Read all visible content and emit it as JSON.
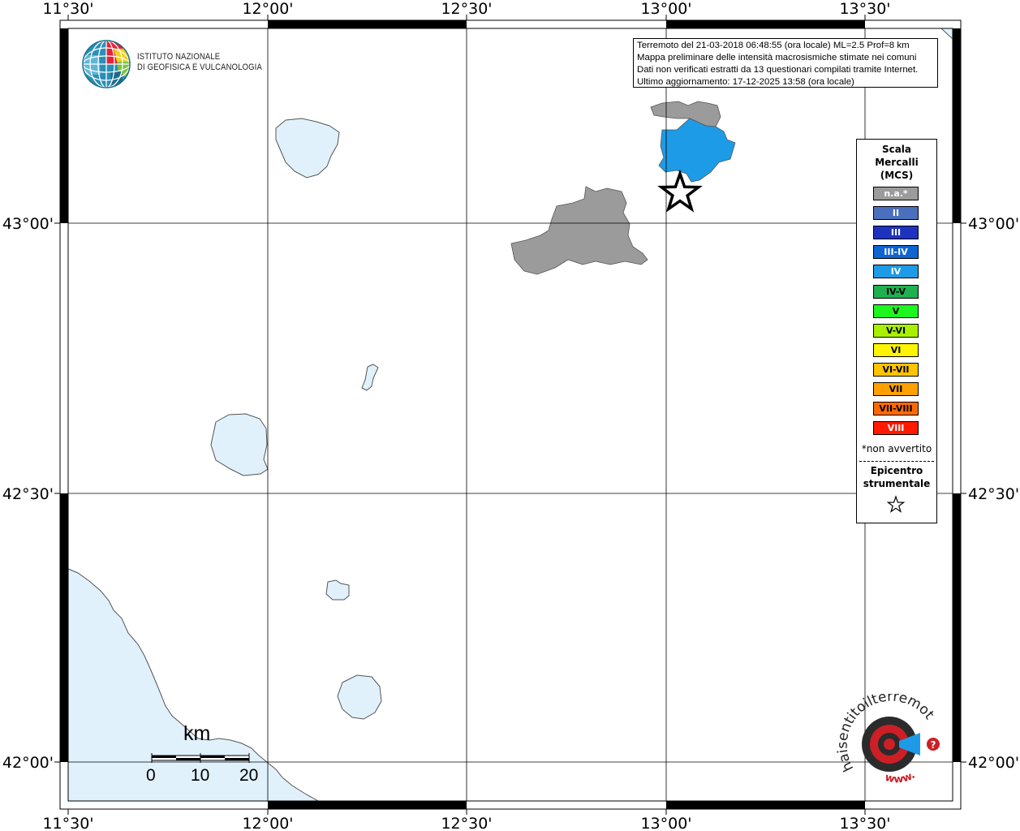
{
  "map": {
    "lon_labels": [
      "11°30'",
      "12°00'",
      "12°30'",
      "13°00'",
      "13°30'"
    ],
    "lat_labels": [
      "43°00'",
      "42°30'",
      "42°00'"
    ],
    "colors": {
      "land_unaffected": "#ffffff",
      "water": "#e0f1fb",
      "coast_line": "#555555",
      "grid": "#000000"
    }
  },
  "info": {
    "line1": "Terremoto del 21-03-2018 06:48:55 (ora locale) ML=2.5 Prof=8 km",
    "line2": "Mappa preliminare delle intensità macrosismiche stimate nei comuni",
    "line3": "Dati non verificati estratti da 13 questionari compilati tramite Internet.",
    "line4": "Ultimo aggiornamento: 17-12-2025 13:58 (ora locale)"
  },
  "logo": {
    "line1": "ISTITUTO NAZIONALE",
    "line2": "DI GEOFISICA E VULCANOLOGIA"
  },
  "legend": {
    "title1": "Scala",
    "title2": "Mercalli",
    "title3": "(MCS)",
    "classes": [
      {
        "label": "n.a.*",
        "color": "#9b9b9b",
        "text_color": "#ffffff"
      },
      {
        "label": "II",
        "color": "#4a6fbd",
        "text_color": "#ffffff"
      },
      {
        "label": "III",
        "color": "#1d33c0",
        "text_color": "#ffffff"
      },
      {
        "label": "III-IV",
        "color": "#0f64d2",
        "text_color": "#ffffff"
      },
      {
        "label": "IV",
        "color": "#1e9be6",
        "text_color": "#ffffff"
      },
      {
        "label": "IV-V",
        "color": "#1fb050",
        "text_color": "#000000"
      },
      {
        "label": "V",
        "color": "#1cf51e",
        "text_color": "#000000"
      },
      {
        "label": "V-VI",
        "color": "#a8f000",
        "text_color": "#000000"
      },
      {
        "label": "VI",
        "color": "#fff500",
        "text_color": "#000000"
      },
      {
        "label": "VI-VII",
        "color": "#ffc300",
        "text_color": "#000000"
      },
      {
        "label": "VII",
        "color": "#ffa000",
        "text_color": "#000000"
      },
      {
        "label": "VII-VIII",
        "color": "#ff6a00",
        "text_color": "#000000"
      },
      {
        "label": "VIII",
        "color": "#ff1a00",
        "text_color": "#ffffff"
      }
    ],
    "note": "*non avvertito",
    "epi1": "Epicentro",
    "epi2": "strumentale",
    "star_icon": "star-outline-icon"
  },
  "scalebar": {
    "unit": "km",
    "labels": [
      "0",
      "10",
      "20"
    ]
  },
  "hsit": {
    "text_top": "haisentitoilterremoto.it",
    "text_bottom": "www.",
    "q": "?"
  }
}
